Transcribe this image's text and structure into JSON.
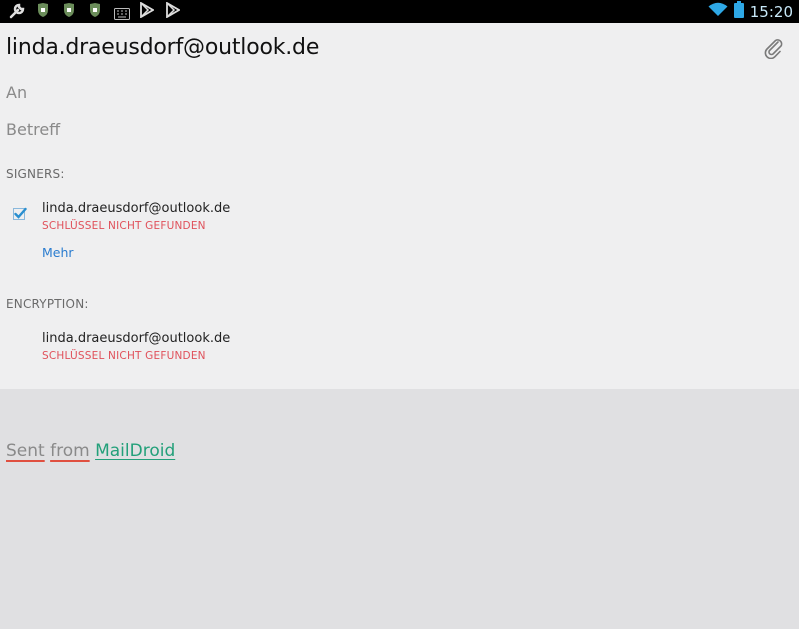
{
  "status_bar": {
    "time": "15:20",
    "left_icons": [
      "wrench-icon",
      "shield-icon",
      "shield-icon",
      "shield-icon",
      "keyboard-icon",
      "play-store-icon",
      "play-store-icon"
    ],
    "right_icons": [
      "wifi-icon",
      "battery-icon"
    ]
  },
  "compose": {
    "from": "linda.draeusdorf@outlook.de",
    "to_placeholder": "An",
    "subject_placeholder": "Betreff",
    "signers_label": "SIGNERS:",
    "signer": {
      "email": "linda.draeusdorf@outlook.de",
      "status": "SCHLÜSSEL NICHT GEFUNDEN",
      "checked": true,
      "more_label": "Mehr"
    },
    "encryption_label": "ENCRYPTION:",
    "encryption": {
      "email": "linda.draeusdorf@outlook.de",
      "status": "SCHLÜSSEL NICHT GEFUNDEN"
    }
  },
  "body": {
    "signature_sent": "Sent",
    "signature_from": "from",
    "signature_app": "MailDroid"
  },
  "colors": {
    "warning": "#e0505a",
    "link": "#2a7ccf",
    "app_link": "#23a07a",
    "checkbox": "#2a8fd0"
  }
}
